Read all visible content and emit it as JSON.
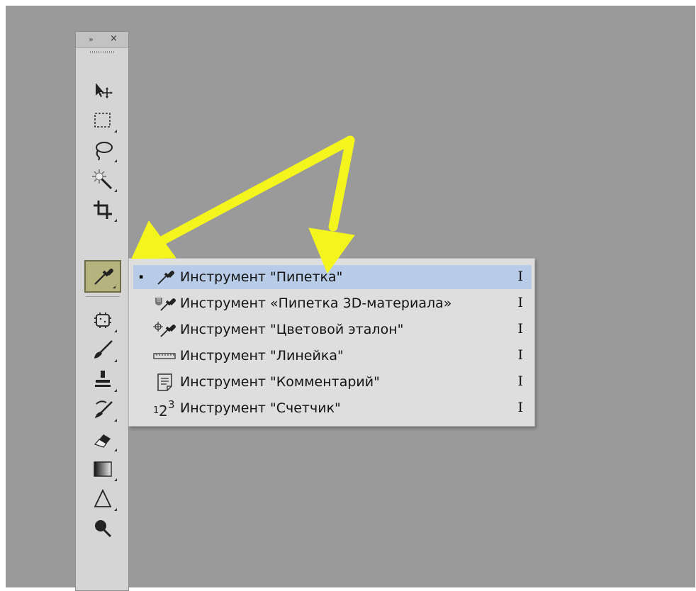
{
  "toolbar": {
    "expand_glyph": "»",
    "close_glyph": "×",
    "tools": [
      {
        "name": "move-tool",
        "icon": "move-icon"
      },
      {
        "name": "marquee-tool",
        "icon": "marquee-icon"
      },
      {
        "name": "lasso-tool",
        "icon": "lasso-icon"
      },
      {
        "name": "magic-wand-tool",
        "icon": "magic-wand-icon"
      },
      {
        "name": "crop-tool",
        "icon": "crop-icon"
      },
      {
        "name": "eyedropper-tool",
        "icon": "eyedropper-icon",
        "active": true
      },
      {
        "name": "spot-healing-tool",
        "icon": "bandage-icon"
      },
      {
        "name": "brush-tool",
        "icon": "brush-icon"
      },
      {
        "name": "clone-stamp-tool",
        "icon": "stamp-icon"
      },
      {
        "name": "history-brush-tool",
        "icon": "history-brush-icon"
      },
      {
        "name": "eraser-tool",
        "icon": "eraser-icon"
      },
      {
        "name": "gradient-tool",
        "icon": "gradient-icon"
      },
      {
        "name": "blur-tool",
        "icon": "blur-icon"
      },
      {
        "name": "dodge-tool",
        "icon": "dodge-icon"
      }
    ]
  },
  "flyout": {
    "selected_bullet": "▪",
    "items": [
      {
        "label": "Инструмент \"Пипетка\"",
        "shortcut": "I",
        "icon": "eyedropper-icon",
        "selected": true
      },
      {
        "label": "Инструмент «Пипетка 3D-материала»",
        "shortcut": "I",
        "icon": "3d-material-eyedropper-icon"
      },
      {
        "label": "Инструмент \"Цветовой эталон\"",
        "shortcut": "I",
        "icon": "color-sampler-icon"
      },
      {
        "label": "Инструмент \"Линейка\"",
        "shortcut": "I",
        "icon": "ruler-icon"
      },
      {
        "label": "Инструмент \"Комментарий\"",
        "shortcut": "I",
        "icon": "note-icon"
      },
      {
        "label": "Инструмент \"Счетчик\"",
        "shortcut": "I",
        "icon": "count-icon"
      }
    ]
  },
  "colors": {
    "canvas_bg": "#9a9a9a",
    "panel_bg": "#d5d5d5",
    "menu_bg": "#dedede",
    "menu_selected_bg": "#b8cbe7",
    "active_tool_bg": "#b5b37e",
    "annotation_arrow": "#f5f51e"
  }
}
